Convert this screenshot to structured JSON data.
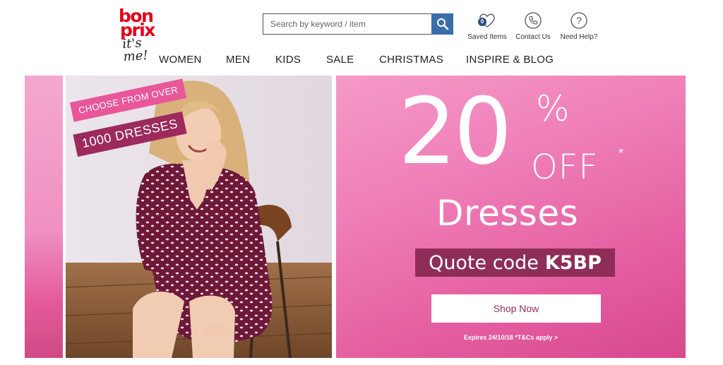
{
  "logo": {
    "line1": "bon",
    "line2": "prix",
    "tagline": "it's me!"
  },
  "search": {
    "placeholder": "Search by keyword / item"
  },
  "utility": {
    "saved": {
      "label": "Saved Items",
      "count": "0"
    },
    "contact": {
      "label": "Contact Us"
    },
    "help": {
      "label": "Need Help?"
    }
  },
  "nav": {
    "items": [
      "WOMEN",
      "MEN",
      "KIDS",
      "SALE",
      "CHRISTMAS",
      "INSPIRE & BLOG"
    ]
  },
  "banner": {
    "tag_top": "CHOOSE FROM OVER",
    "tag_bottom": "1000 DRESSES",
    "discount_number": "20",
    "discount_sign": "%",
    "discount_off": "OFF",
    "asterisk": "*",
    "product": "Dresses",
    "quote_prefix": "Quote code",
    "quote_code": "K5BP",
    "cta": "Shop Now",
    "terms": "Expires 24/10/18 *T&Cs apply >"
  },
  "colors": {
    "brand_red": "#e2001a",
    "search_button": "#3a6ea8",
    "promo_pink": "#e35b9e",
    "code_box": "#8e2d57"
  }
}
